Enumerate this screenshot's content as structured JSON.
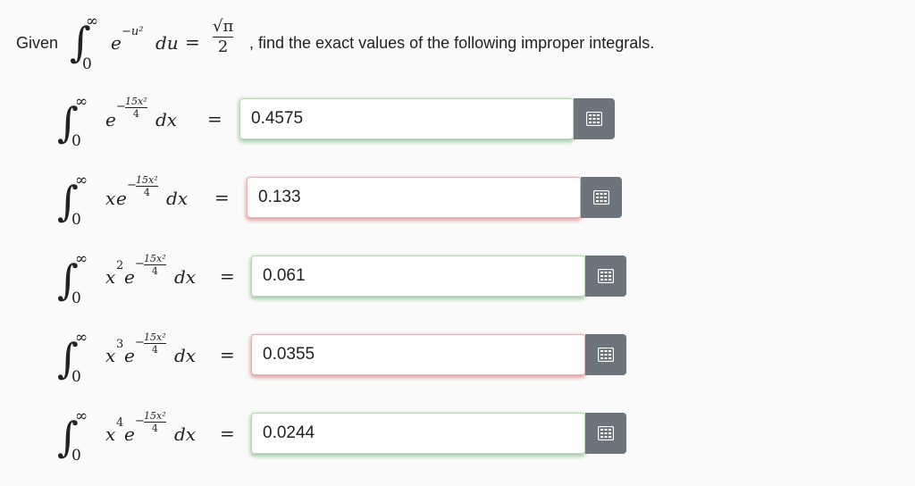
{
  "header": {
    "given_label": "Given",
    "integral_upper": "∞",
    "integral_lower": "0",
    "integrand_base": "e",
    "integrand_exponent": "−u²",
    "differential": "du",
    "equals": "=",
    "frac_numerator": "√π",
    "frac_denominator": "2",
    "instruction": ", find the exact values of the following improper integrals."
  },
  "problems": [
    {
      "prefix": "",
      "power": "",
      "exp_numerator": "15x²",
      "exp_denominator": "4",
      "differential": "dx",
      "equals": "=",
      "answer": "0.4575",
      "status": "correct"
    },
    {
      "prefix": "x",
      "power": "",
      "exp_numerator": "15x²",
      "exp_denominator": "4",
      "differential": "dx",
      "equals": "=",
      "answer": "0.133",
      "status": "incorrect"
    },
    {
      "prefix": "x",
      "power": "2",
      "exp_numerator": "15x²",
      "exp_denominator": "4",
      "differential": "dx",
      "equals": "=",
      "answer": "0.061",
      "status": "correct"
    },
    {
      "prefix": "x",
      "power": "3",
      "exp_numerator": "15x²",
      "exp_denominator": "4",
      "differential": "dx",
      "equals": "=",
      "answer": "0.0355",
      "status": "incorrect"
    },
    {
      "prefix": "x",
      "power": "4",
      "exp_numerator": "15x²",
      "exp_denominator": "4",
      "differential": "dx",
      "equals": "=",
      "answer": "0.0244",
      "status": "correct"
    }
  ],
  "icons": {
    "keyboard_button": "calculator-keypad-icon"
  },
  "colors": {
    "correct": "#60aa60",
    "incorrect": "#cd5a5a",
    "button": "#6c757d"
  }
}
